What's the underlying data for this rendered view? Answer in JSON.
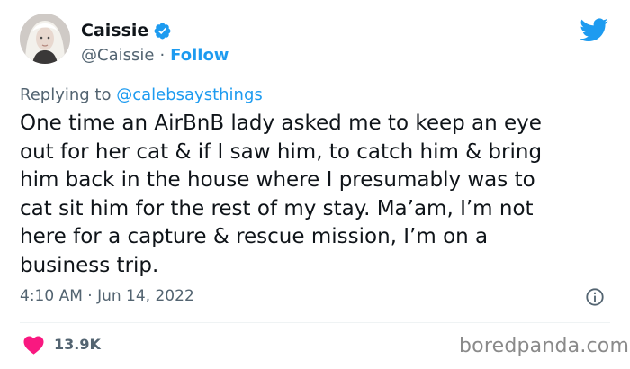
{
  "author": {
    "name": "Caissie",
    "handle": "@Caissie",
    "separator": "·",
    "follow_label": "Follow"
  },
  "reply": {
    "prefix": "Replying to",
    "mention": "@calebsaysthings"
  },
  "tweet": {
    "lines": [
      "One time an AirBnB lady asked me to keep an eye",
      "out for her cat & if I saw him, to catch him & bring",
      "him back in the house where I presumably was to",
      "cat sit him for the rest of my stay. Ma’am, I’m not",
      "here for a capture & rescue mission, I’m on a",
      "business trip."
    ],
    "timestamp": "4:10 AM · Jun 14, 2022"
  },
  "engagement": {
    "likes": "13.9K"
  },
  "watermark": "boredpanda.com",
  "colors": {
    "accent": "#1d9bf0",
    "heart": "#f91880",
    "secondary_text": "#536471"
  },
  "icons": [
    "verified-badge-icon",
    "twitter-bird-icon",
    "info-icon",
    "heart-icon"
  ]
}
